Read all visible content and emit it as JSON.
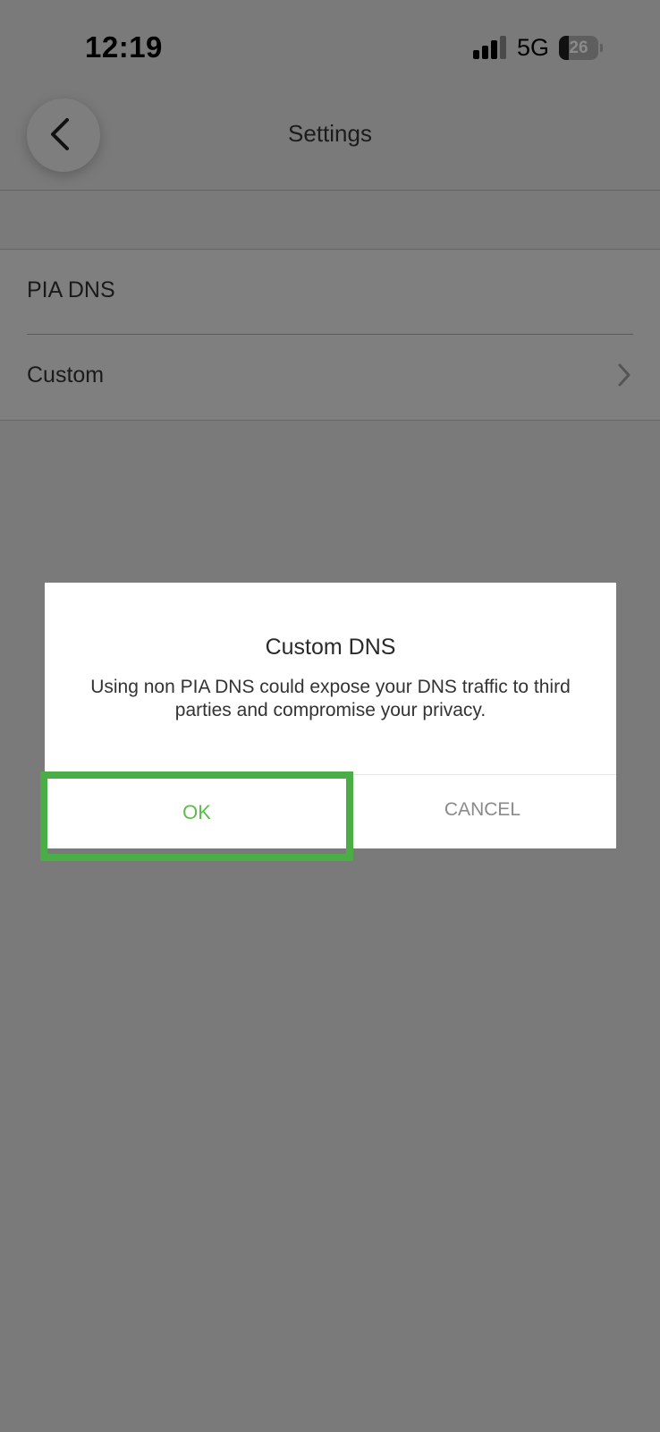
{
  "status_bar": {
    "time": "12:19",
    "network": "5G",
    "battery_level": "26",
    "battery_fraction": 0.26
  },
  "header": {
    "title": "Settings",
    "back_icon": "chevron-left-icon"
  },
  "dns_options": {
    "items": [
      {
        "label": "PIA DNS"
      },
      {
        "label": "Custom",
        "icon": "chevron-right-icon"
      }
    ]
  },
  "dialog": {
    "title": "Custom DNS",
    "message": "Using non PIA DNS could expose your DNS traffic to third parties and compromise your privacy.",
    "ok_label": "OK",
    "cancel_label": "CANCEL"
  },
  "colors": {
    "accent": "#5cbe4a",
    "highlight": "#4aad46",
    "overlay": "#7a7a7a"
  }
}
